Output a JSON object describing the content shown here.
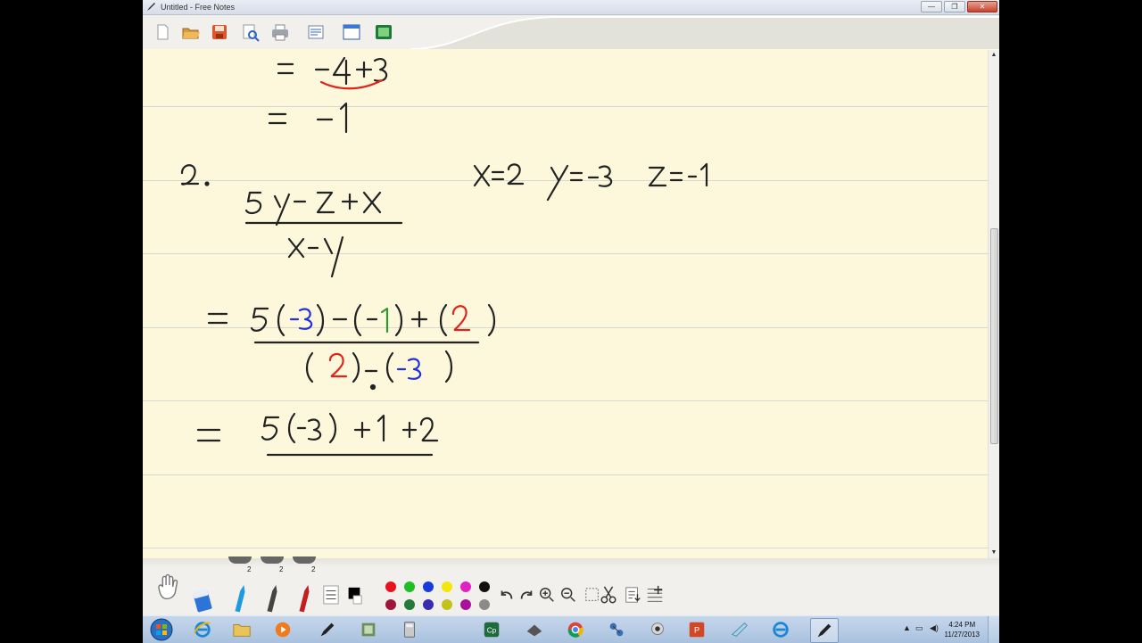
{
  "window": {
    "title": "Untitled - Free Notes",
    "minimize_glyph": "—",
    "maximize_glyph": "❐",
    "close_glyph": "✕"
  },
  "toolbar": {
    "buttons": [
      "new-page-icon",
      "open-folder-icon",
      "save-icon",
      "print-preview-icon",
      "print-icon",
      "settings-icon",
      "window-icon",
      "screen-capture-icon"
    ]
  },
  "notes": {
    "strokes": [
      {
        "text": "= -4+3",
        "color": "#222222"
      },
      {
        "text": "= -1",
        "color": "#222222"
      },
      {
        "text": "2.",
        "color": "#222222"
      },
      {
        "text": "x=2  y=-3  z=-1",
        "color": "#222222"
      },
      {
        "text": "5y - z + x",
        "color": "#222222"
      },
      {
        "text": "x - y",
        "color": "#222222"
      },
      {
        "text": "= 5(-3) - (-1) + (2)",
        "color": "#222222"
      },
      {
        "text": "(2) - (-3)",
        "color": "#222222"
      },
      {
        "text": "= 5(-3) + 1 + 2",
        "color": "#222222"
      }
    ],
    "highlight_colors": {
      "red": "#e2231a",
      "blue": "#2230d8",
      "green": "#2e9a2e"
    }
  },
  "pen_widths": [
    "2",
    "2",
    "2"
  ],
  "palette": {
    "row1": [
      "#e8121f",
      "#1fbe22",
      "#1a3bdc",
      "#f3e60b",
      "#e021c4",
      "#111111"
    ],
    "row2": [
      "#a0163a",
      "#247a3a",
      "#3a2bb0",
      "#c3c21a",
      "#a8129a",
      "#8a8a8a"
    ]
  },
  "taskbar": {
    "apps": [
      "start-orb-icon",
      "internet-explorer-icon",
      "file-explorer-icon",
      "media-player-icon",
      "free-notes-icon",
      "app-icon",
      "calculator-icon",
      "captivate-icon",
      "app-icon-2",
      "chrome-icon",
      "network-app-icon",
      "webcam-icon",
      "powerpoint-icon",
      "notepad-icon",
      "internet-explorer-icon-2",
      "free-notes-icon-2"
    ],
    "time": "4:24 PM",
    "date": "11/27/2013"
  }
}
